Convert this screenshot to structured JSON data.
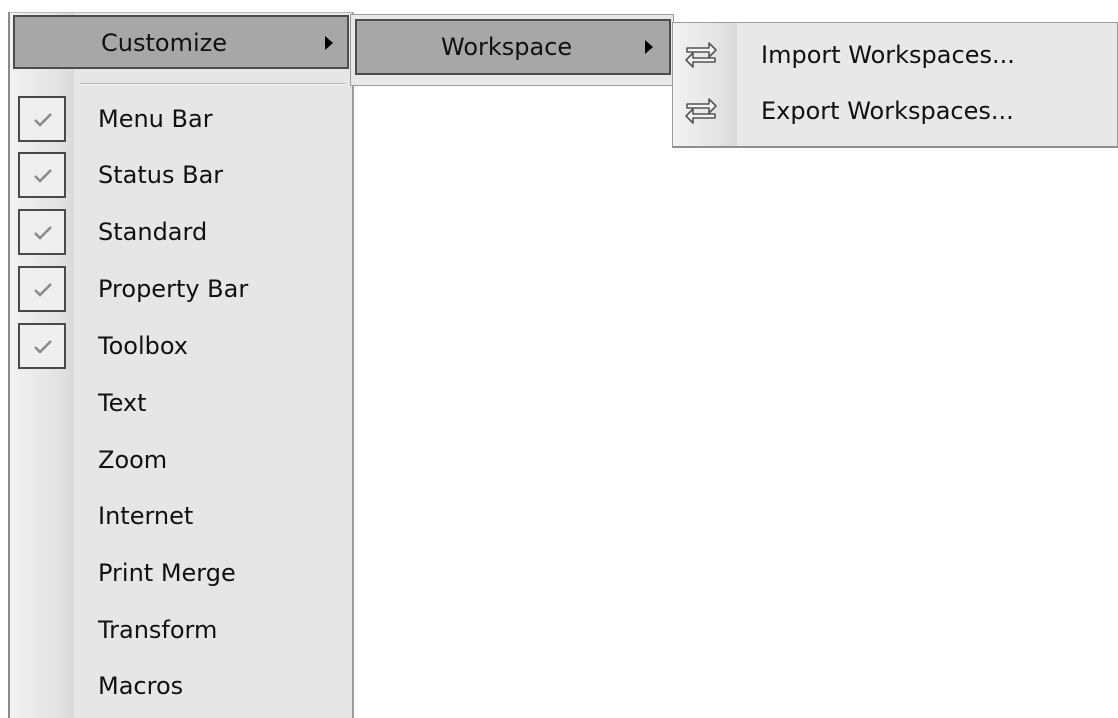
{
  "customize_menu": {
    "label": "Customize",
    "items": [
      {
        "label": "Menu Bar",
        "checked": true
      },
      {
        "label": "Status Bar",
        "checked": true
      },
      {
        "label": "Standard",
        "checked": true
      },
      {
        "label": "Property Bar",
        "checked": true
      },
      {
        "label": "Toolbox",
        "checked": true
      },
      {
        "label": "Text",
        "checked": false
      },
      {
        "label": "Zoom",
        "checked": false
      },
      {
        "label": "Internet",
        "checked": false
      },
      {
        "label": "Print Merge",
        "checked": false
      },
      {
        "label": "Transform",
        "checked": false
      },
      {
        "label": "Macros",
        "checked": false
      }
    ]
  },
  "workspace_menu": {
    "label": "Workspace"
  },
  "workspace_submenu": {
    "items": [
      {
        "label": "Import Workspaces...",
        "icon": "swap-arrows-icon"
      },
      {
        "label": "Export Workspaces...",
        "icon": "swap-arrows-icon"
      }
    ]
  },
  "colors": {
    "menu_background": "#e6e6e6",
    "highlight": "#a7a7a7",
    "highlight_border": "#4d4d4d",
    "text": "#111111"
  }
}
